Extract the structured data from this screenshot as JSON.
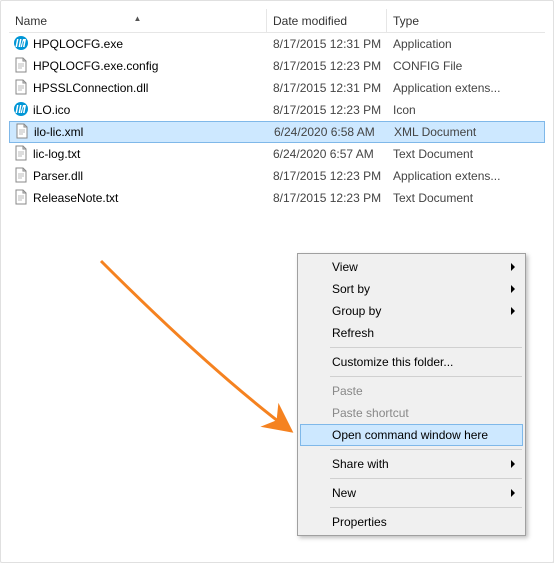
{
  "header": {
    "name": "Name",
    "date": "Date modified",
    "type": "Type"
  },
  "files": [
    {
      "name": "HPQLOCFG.exe",
      "date": "8/17/2015 12:31 PM",
      "type": "Application",
      "icon": "hp"
    },
    {
      "name": "HPQLOCFG.exe.config",
      "date": "8/17/2015 12:23 PM",
      "type": "CONFIG File",
      "icon": "file"
    },
    {
      "name": "HPSSLConnection.dll",
      "date": "8/17/2015 12:31 PM",
      "type": "Application extens...",
      "icon": "file"
    },
    {
      "name": "iLO.ico",
      "date": "8/17/2015 12:23 PM",
      "type": "Icon",
      "icon": "hp"
    },
    {
      "name": "ilo-lic.xml",
      "date": "6/24/2020 6:58 AM",
      "type": "XML Document",
      "icon": "file",
      "selected": true
    },
    {
      "name": "lic-log.txt",
      "date": "6/24/2020 6:57 AM",
      "type": "Text Document",
      "icon": "file"
    },
    {
      "name": "Parser.dll",
      "date": "8/17/2015 12:23 PM",
      "type": "Application extens...",
      "icon": "file"
    },
    {
      "name": "ReleaseNote.txt",
      "date": "8/17/2015 12:23 PM",
      "type": "Text Document",
      "icon": "file"
    }
  ],
  "ctx": {
    "view": "View",
    "sort": "Sort by",
    "group": "Group by",
    "refresh": "Refresh",
    "customize": "Customize this folder...",
    "paste": "Paste",
    "paste_sc": "Paste shortcut",
    "cmd": "Open command window here",
    "share": "Share with",
    "new": "New",
    "props": "Properties"
  },
  "colors": {
    "accent": "#f58220"
  }
}
